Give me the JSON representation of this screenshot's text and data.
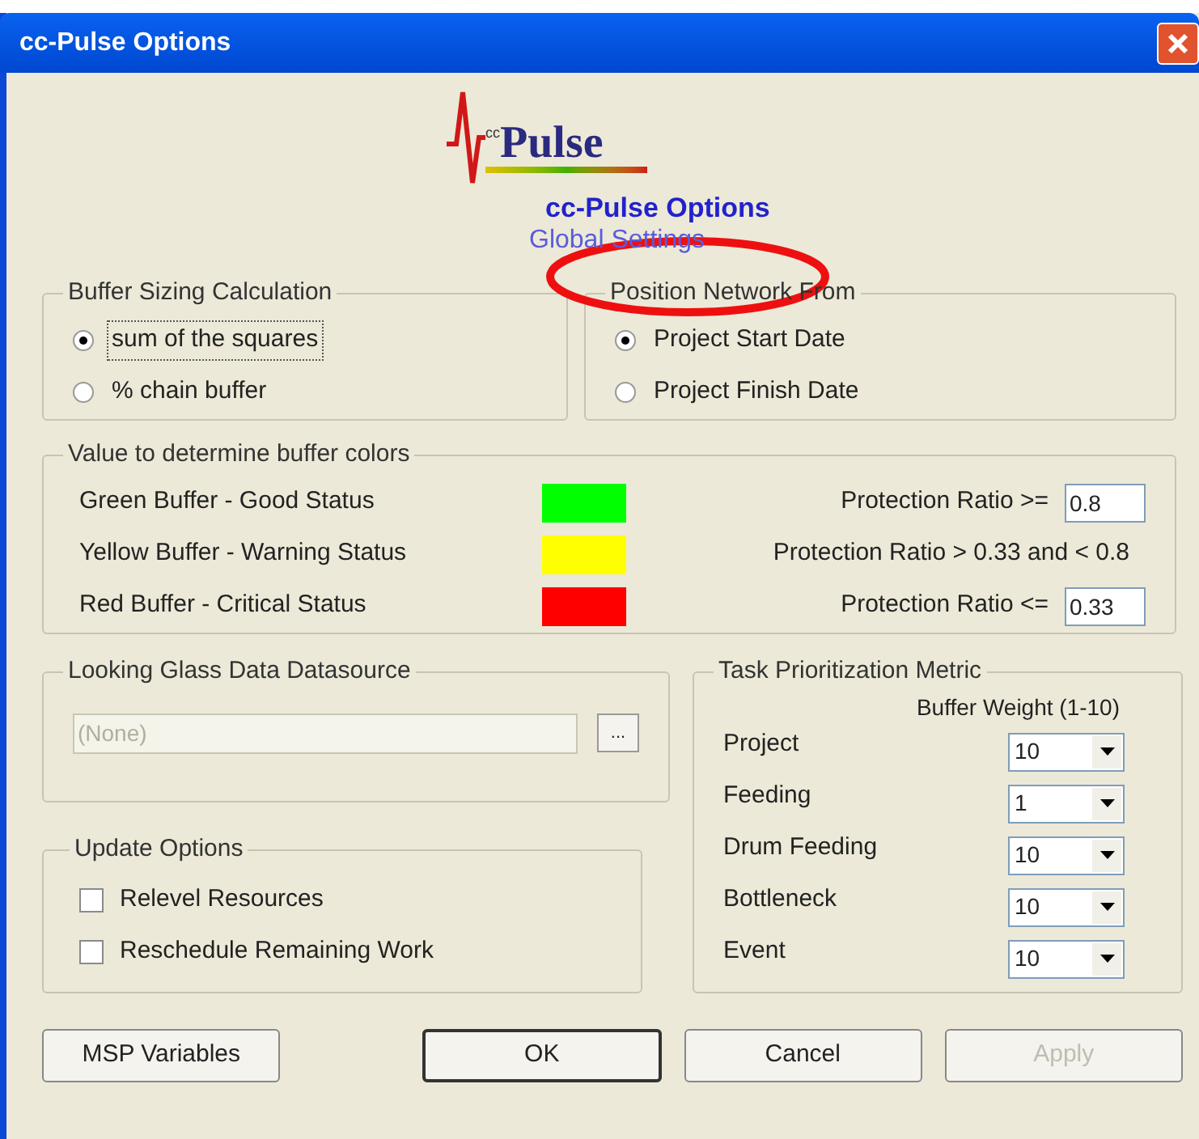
{
  "window": {
    "title": "cc-Pulse Options"
  },
  "logo": {
    "prefix": "cc",
    "name": "Pulse"
  },
  "heading": "cc-Pulse Options",
  "subheading": "Global Settings",
  "buffer_sizing": {
    "title": "Buffer Sizing Calculation",
    "options": [
      {
        "label": "sum of the squares",
        "selected": true,
        "focused": true
      },
      {
        "label": "% chain buffer",
        "selected": false,
        "focused": false
      }
    ]
  },
  "position_network": {
    "title": "Position Network From",
    "options": [
      {
        "label": "Project Start Date",
        "selected": true,
        "focused": false
      },
      {
        "label": "Project Finish Date",
        "selected": false,
        "focused": false
      }
    ]
  },
  "buffer_colors": {
    "title": "Value to determine buffer colors",
    "rows": [
      {
        "label": "Green Buffer - Good Status",
        "color": "#00ff00",
        "condition": "Protection Ratio >=",
        "value": "0.8"
      },
      {
        "label": "Yellow Buffer - Warning Status",
        "color": "#ffff00",
        "condition": "Protection Ratio > 0.33 and < 0.8"
      },
      {
        "label": "Red Buffer - Critical Status",
        "color": "#ff0000",
        "condition": "Protection Ratio <=",
        "value": "0.33"
      }
    ]
  },
  "datasource": {
    "title": "Looking Glass Data Datasource",
    "placeholder": "(None)",
    "disabled": true,
    "browse": "..."
  },
  "update_options": {
    "title": "Update Options",
    "options": [
      {
        "label": "Relevel Resources",
        "checked": false
      },
      {
        "label": "Reschedule Remaining Work",
        "checked": false
      }
    ]
  },
  "prioritization": {
    "title": "Task Prioritization Metric",
    "column_header": "Buffer Weight (1-10)",
    "rows": [
      {
        "label": "Project",
        "value": "10"
      },
      {
        "label": "Feeding",
        "value": "1"
      },
      {
        "label": "Drum Feeding",
        "value": "10"
      },
      {
        "label": "Bottleneck",
        "value": "10"
      },
      {
        "label": "Event",
        "value": "10"
      }
    ]
  },
  "buttons": [
    {
      "label": "MSP Variables",
      "default": false,
      "disabled": false
    },
    {
      "label": "OK",
      "default": true,
      "disabled": false
    },
    {
      "label": "Cancel",
      "default": false,
      "disabled": false
    },
    {
      "label": "Apply",
      "default": false,
      "disabled": true
    }
  ]
}
